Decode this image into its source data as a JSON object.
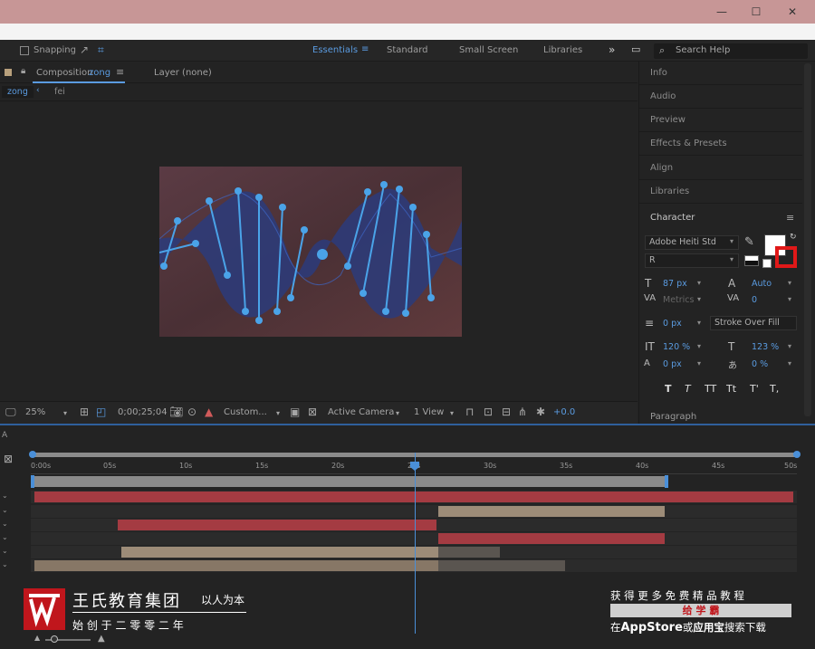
{
  "titlebar": {
    "minimize": "—",
    "maximize": "☐",
    "close": "✕"
  },
  "toolbar": {
    "snapping": "Snapping",
    "workspaces": [
      "Essentials",
      "Standard",
      "Small Screen",
      "Libraries"
    ],
    "more": "»",
    "search_placeholder": "Search Help"
  },
  "composition": {
    "tab_label": "Composition",
    "comp_name": "zong",
    "layer_label": "Layer (none)",
    "sub_tabs": [
      "zong",
      "fei"
    ]
  },
  "viewer_bar": {
    "zoom": "25%",
    "timecode": "0;00;25;04",
    "resolution": "Custom...",
    "camera": "Active Camera",
    "views": "1 View",
    "exposure": "+0.0"
  },
  "right_panel": {
    "items": [
      "Info",
      "Audio",
      "Preview",
      "Effects & Presets",
      "Align",
      "Libraries"
    ],
    "character": {
      "title": "Character",
      "font": "Adobe Heiti Std",
      "style": "R",
      "font_size": "87 px",
      "leading": "Auto",
      "kerning": "Metrics",
      "tracking": "0",
      "stroke_width": "0 px",
      "stroke_type": "Stroke Over Fill",
      "vscale": "120 %",
      "hscale": "123 %",
      "baseline": "0 px",
      "tsume": "0 %",
      "style_buttons": [
        "T",
        "T",
        "TT",
        "Tt",
        "T'",
        "T,"
      ]
    },
    "paragraph": "Paragraph"
  },
  "timeline": {
    "ruler": [
      "0:00s",
      "05s",
      "10s",
      "15s",
      "20s",
      "25s",
      "30s",
      "35s",
      "40s",
      "45s",
      "50s"
    ],
    "colors": {
      "red": "#a43b42",
      "tan": "#877766",
      "tan_light": "#9d8c78",
      "blue": "#4a8fd8"
    }
  },
  "watermark": {
    "company": "王氏教育集团",
    "slogan": "以人为本",
    "founded": "始 创 于 二 零 零 二 年",
    "promo_line1": "获 得 更 多 免 费 精 品 教 程",
    "promo_brand": "给 学 霸",
    "promo_line3_pre": "在",
    "promo_appstore": "AppStore",
    "promo_line3_mid": "或",
    "promo_yyb": "应用宝",
    "promo_line3_post": "搜索下载"
  }
}
